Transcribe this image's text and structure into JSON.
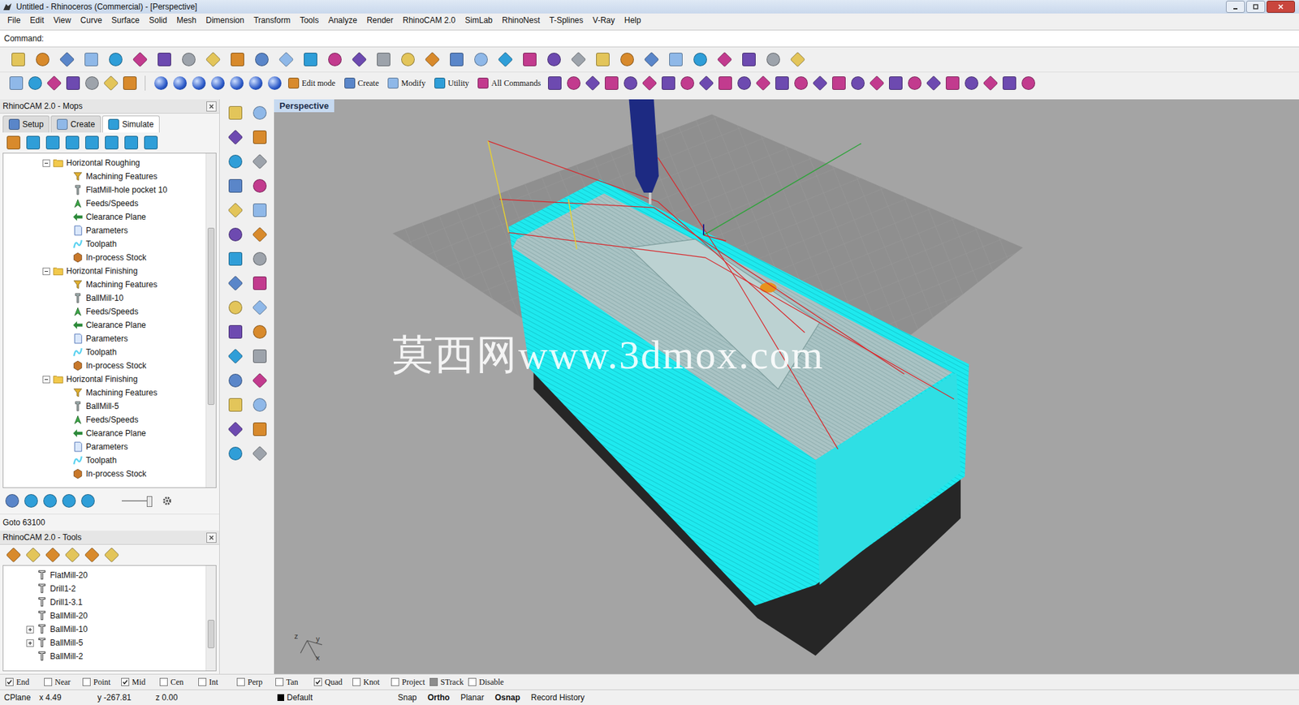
{
  "window": {
    "title": "Untitled - Rhinoceros (Commercial) - [Perspective]"
  },
  "menu": [
    "File",
    "Edit",
    "View",
    "Curve",
    "Surface",
    "Solid",
    "Mesh",
    "Dimension",
    "Transform",
    "Tools",
    "Analyze",
    "Render",
    "RhinoCAM 2.0",
    "SimLab",
    "RhinoNest",
    "T-Splines",
    "V-Ray",
    "Help"
  ],
  "command": {
    "label": "Command:",
    "value": ""
  },
  "toolbar_buttons": [
    "Edit mode",
    "Create",
    "Modify",
    "Utility",
    "All Commands"
  ],
  "mops_panel": {
    "title": "RhinoCAM 2.0 - Mops",
    "tabs": [
      {
        "label": "Setup",
        "selected": false
      },
      {
        "label": "Create",
        "selected": false
      },
      {
        "label": "Simulate",
        "selected": true
      }
    ],
    "tree": [
      {
        "label": "Horizontal Roughing",
        "expanded": true,
        "children": [
          {
            "label": "Machining Features",
            "kind": "features"
          },
          {
            "label": "FlatMill-hole pocket 10",
            "kind": "tool"
          },
          {
            "label": "Feeds/Speeds",
            "kind": "feeds"
          },
          {
            "label": "Clearance Plane",
            "kind": "clearance"
          },
          {
            "label": "Parameters",
            "kind": "parameters"
          },
          {
            "label": "Toolpath",
            "kind": "toolpath"
          },
          {
            "label": "In-process Stock",
            "kind": "stock"
          }
        ]
      },
      {
        "label": "Horizontal Finishing",
        "expanded": true,
        "children": [
          {
            "label": "Machining Features",
            "kind": "features"
          },
          {
            "label": "BallMill-10",
            "kind": "tool"
          },
          {
            "label": "Feeds/Speeds",
            "kind": "feeds"
          },
          {
            "label": "Clearance Plane",
            "kind": "clearance"
          },
          {
            "label": "Parameters",
            "kind": "parameters"
          },
          {
            "label": "Toolpath",
            "kind": "toolpath"
          },
          {
            "label": "In-process Stock",
            "kind": "stock"
          }
        ]
      },
      {
        "label": "Horizontal Finishing",
        "expanded": true,
        "children": [
          {
            "label": "Machining Features",
            "kind": "features"
          },
          {
            "label": "BallMill-5",
            "kind": "tool"
          },
          {
            "label": "Feeds/Speeds",
            "kind": "feeds"
          },
          {
            "label": "Clearance Plane",
            "kind": "clearance"
          },
          {
            "label": "Parameters",
            "kind": "parameters"
          },
          {
            "label": "Toolpath",
            "kind": "toolpath"
          },
          {
            "label": "In-process Stock",
            "kind": "stock"
          }
        ]
      }
    ],
    "slider": {
      "level": 0.9
    },
    "status": "Goto 63100"
  },
  "tools_panel": {
    "title": "RhinoCAM 2.0 - Tools",
    "tools": [
      {
        "label": "FlatMill-20",
        "has_children": false,
        "expanded": false
      },
      {
        "label": "Drill1-2",
        "has_children": false,
        "expanded": false
      },
      {
        "label": "Drill1-3.1",
        "has_children": false,
        "expanded": false
      },
      {
        "label": "BallMill-20",
        "has_children": false,
        "expanded": false
      },
      {
        "label": "BallMill-10",
        "has_children": true,
        "expanded": false
      },
      {
        "label": "BallMill-5",
        "has_children": true,
        "expanded": false
      },
      {
        "label": "BallMill-2",
        "has_children": false,
        "expanded": false
      }
    ]
  },
  "viewport": {
    "label": "Perspective",
    "watermark": "莫西网www.3dmox.com",
    "axes": [
      "z",
      "y",
      "x"
    ]
  },
  "osnap": [
    {
      "label": "End",
      "checked": true,
      "pressed": false
    },
    {
      "label": "Near",
      "checked": false,
      "pressed": false
    },
    {
      "label": "Point",
      "checked": false,
      "pressed": false
    },
    {
      "label": "Mid",
      "checked": true,
      "pressed": false
    },
    {
      "label": "Cen",
      "checked": false,
      "pressed": false
    },
    {
      "label": "Int",
      "checked": false,
      "pressed": false
    },
    {
      "label": "Perp",
      "checked": false,
      "pressed": false
    },
    {
      "label": "Tan",
      "checked": false,
      "pressed": false
    },
    {
      "label": "Quad",
      "checked": true,
      "pressed": false
    },
    {
      "label": "Knot",
      "checked": false,
      "pressed": false
    },
    {
      "label": "Project",
      "checked": false,
      "pressed": false
    },
    {
      "label": "STrack",
      "checked": false,
      "pressed": true
    },
    {
      "label": "Disable",
      "checked": false,
      "pressed": false
    }
  ],
  "status_bar": {
    "cplane": "CPlane",
    "x": "x 4.49",
    "y": "y -267.81",
    "z": "z 0.00",
    "layer": {
      "name": "Default",
      "color": "#000000"
    },
    "toggles": [
      {
        "label": "Snap",
        "active": false
      },
      {
        "label": "Ortho",
        "active": true
      },
      {
        "label": "Planar",
        "active": false
      },
      {
        "label": "Osnap",
        "active": true
      },
      {
        "label": "Record History",
        "active": false
      }
    ]
  }
}
